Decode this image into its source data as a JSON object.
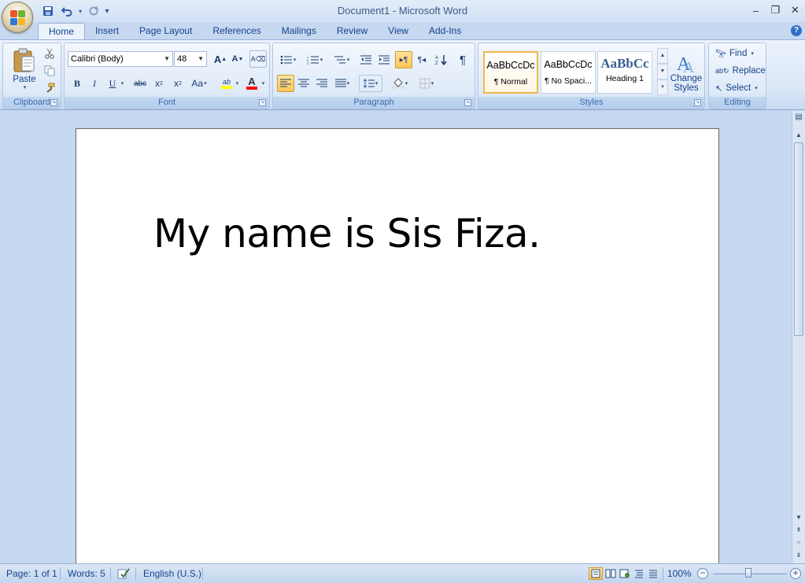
{
  "window": {
    "title": "Document1 - Microsoft Word"
  },
  "qat": {
    "save_icon": "save-icon",
    "undo_icon": "undo-icon",
    "redo_icon": "redo-icon"
  },
  "tabs": [
    {
      "label": "Home",
      "active": true
    },
    {
      "label": "Insert"
    },
    {
      "label": "Page Layout"
    },
    {
      "label": "References"
    },
    {
      "label": "Mailings"
    },
    {
      "label": "Review"
    },
    {
      "label": "View"
    },
    {
      "label": "Add-Ins"
    }
  ],
  "ribbon": {
    "clipboard": {
      "label": "Clipboard",
      "paste_label": "Paste"
    },
    "font": {
      "label": "Font",
      "family": "Calibri (Body)",
      "size": "48",
      "change_case": "Aa"
    },
    "paragraph": {
      "label": "Paragraph"
    },
    "styles": {
      "label": "Styles",
      "items": [
        {
          "sample": "AaBbCcDc",
          "name": "¶ Normal",
          "selected": true
        },
        {
          "sample": "AaBbCcDc",
          "name": "¶ No Spaci..."
        },
        {
          "sample": "AaBbCc",
          "name": "Heading 1"
        }
      ],
      "change_styles_line1": "Change",
      "change_styles_line2": "Styles"
    },
    "editing": {
      "label": "Editing",
      "find": "Find",
      "replace": "Replace",
      "select": "Select"
    }
  },
  "document": {
    "text": "My name is Sis Fiza."
  },
  "status": {
    "page": "Page: 1 of 1",
    "words": "Words: 5",
    "language": "English (U.S.)",
    "zoom": "100%"
  },
  "colors": {
    "highlight": "#ffff00",
    "font_color": "#ff0000",
    "accent": "#15428b"
  }
}
